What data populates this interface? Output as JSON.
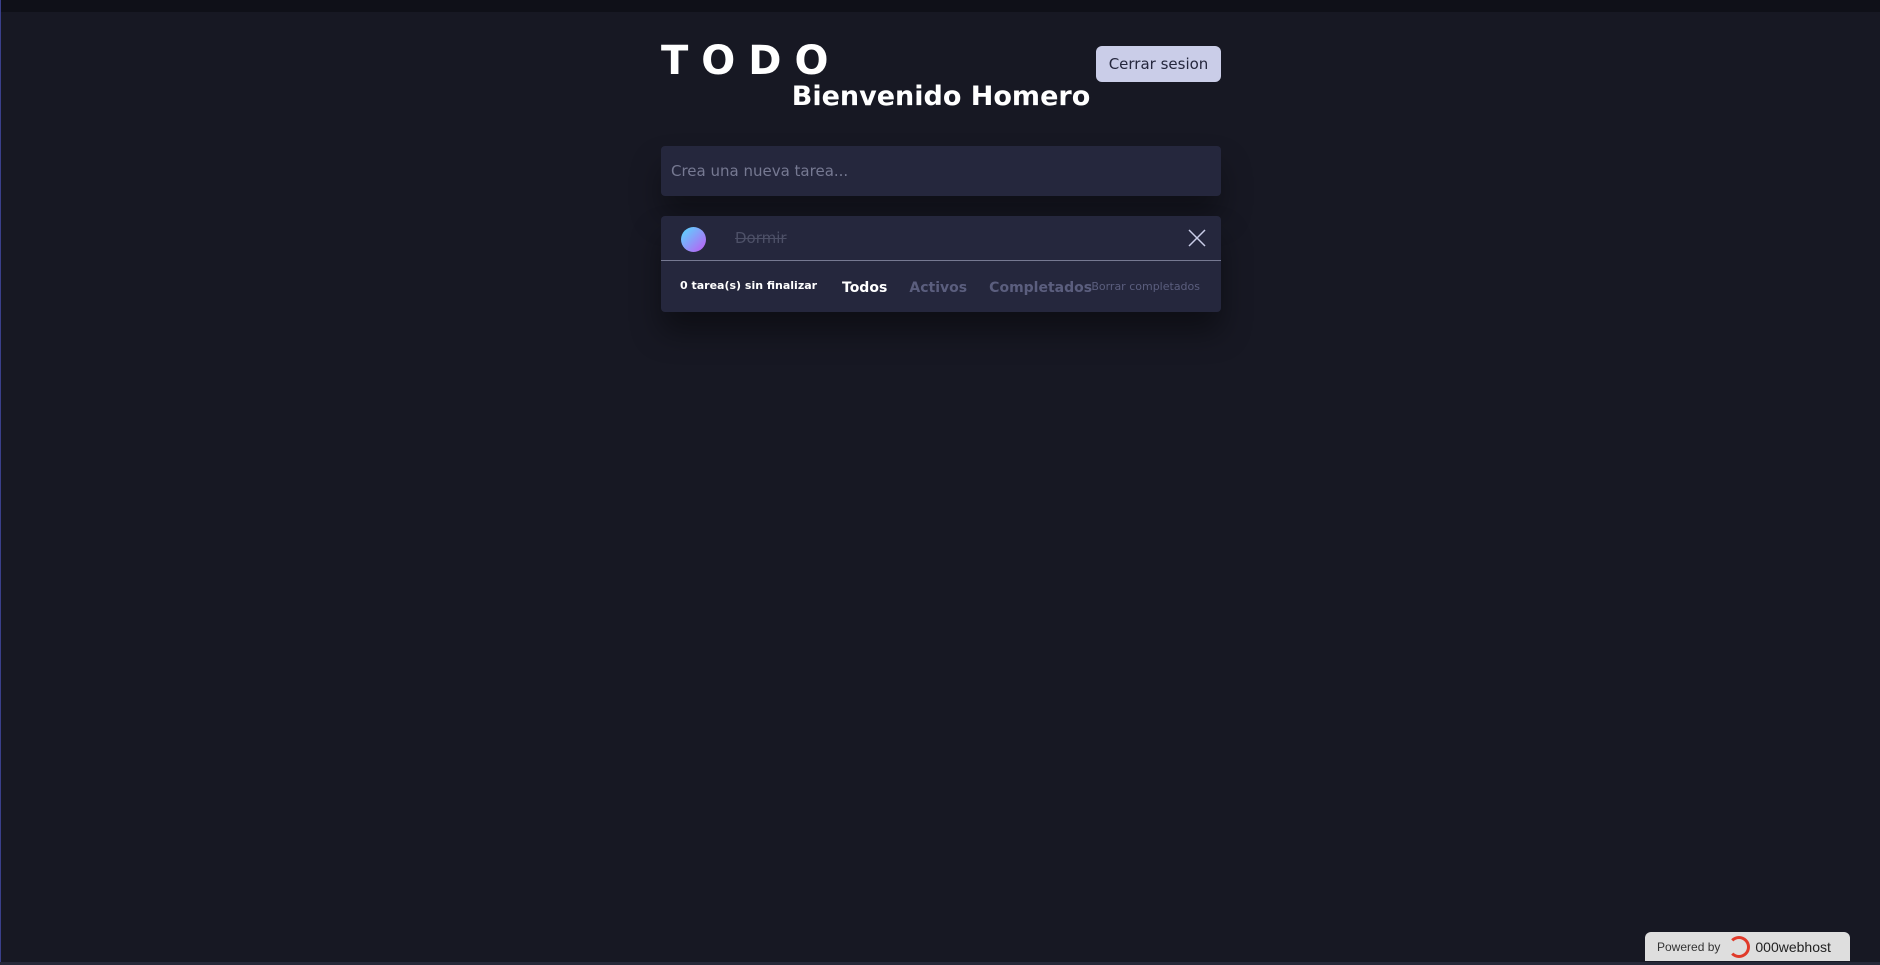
{
  "app": {
    "title": "TODO",
    "welcome": "Bienvenido Homero",
    "logout_label": "Cerrar sesion"
  },
  "new_task": {
    "placeholder": "Crea una nueva tarea...",
    "value": ""
  },
  "tasks": [
    {
      "text": "Dormir",
      "completed": true
    }
  ],
  "footer": {
    "count_text": "0 tarea(s) sin finalizar",
    "filters": [
      "Todos",
      "Activos",
      "Completados"
    ],
    "active_filter": "Todos",
    "clear_label": "Borrar completados"
  },
  "powered_by": {
    "label": "Powered by",
    "host": "000webhost"
  },
  "colors": {
    "background": "#171823",
    "card": "#25273d",
    "button": "#cacde8",
    "check_gradient_start": "#55ddff",
    "check_gradient_end": "#c058f3"
  },
  "icons": {
    "task_check": "check-circle-icon",
    "task_delete": "close-icon",
    "host_logo": "webhost-logo-icon"
  }
}
